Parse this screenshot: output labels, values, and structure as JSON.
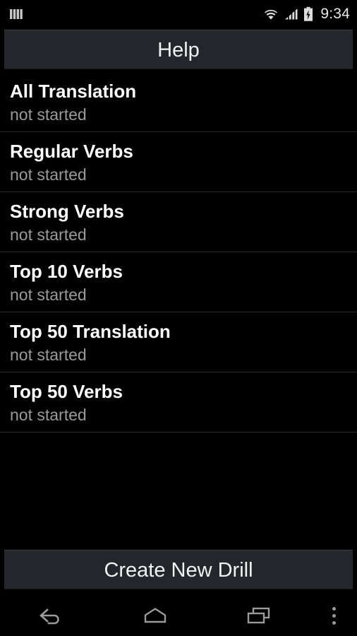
{
  "status_bar": {
    "notification_icon": "notification-bars-icon",
    "wifi_icon": "wifi-icon",
    "signal_icon": "cellular-signal-icon",
    "battery_icon": "battery-charging-icon",
    "time": "9:34"
  },
  "top_bar": {
    "help_label": "Help"
  },
  "drills": [
    {
      "title": "All Translation",
      "status": "not started"
    },
    {
      "title": "Regular Verbs",
      "status": "not started"
    },
    {
      "title": "Strong Verbs",
      "status": "not started"
    },
    {
      "title": "Top 10 Verbs",
      "status": "not started"
    },
    {
      "title": "Top 50 Translation",
      "status": "not started"
    },
    {
      "title": "Top 50 Verbs",
      "status": "not started"
    }
  ],
  "bottom_bar": {
    "create_label": "Create New Drill"
  },
  "nav_bar": {
    "back_icon": "back-arrow-icon",
    "home_icon": "home-icon",
    "recents_icon": "recent-apps-icon",
    "overflow_icon": "overflow-menu-icon"
  },
  "colors": {
    "background": "#000000",
    "button_bg": "#23272c",
    "title_text": "#ffffff",
    "status_text": "#9a9a9a",
    "divider": "#2a2a2a",
    "nav_icon": "#9a9a9a"
  }
}
